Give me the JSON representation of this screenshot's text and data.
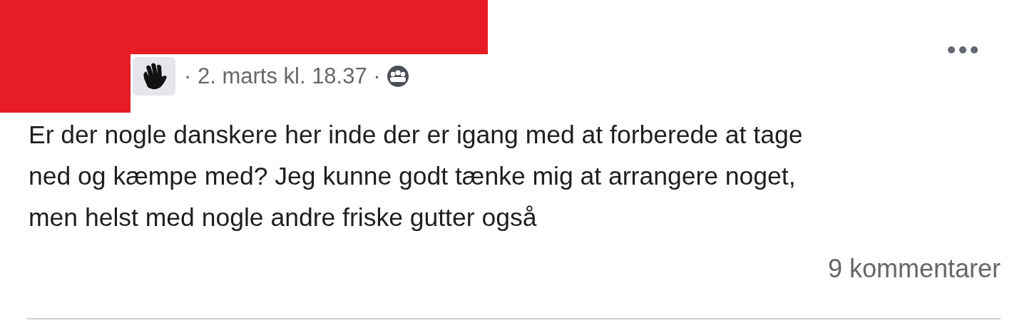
{
  "post": {
    "meta": "· 2. marts kl. 18.37 ·",
    "body": "Er der nogle danskere her inde der er igang med at forberede at tage\nned og kæmpe med? Jeg kunne godt tænke mig at arrangere noget,\nmen helst med nogle andre friske gutter også",
    "comments": "9 kommentarer"
  }
}
